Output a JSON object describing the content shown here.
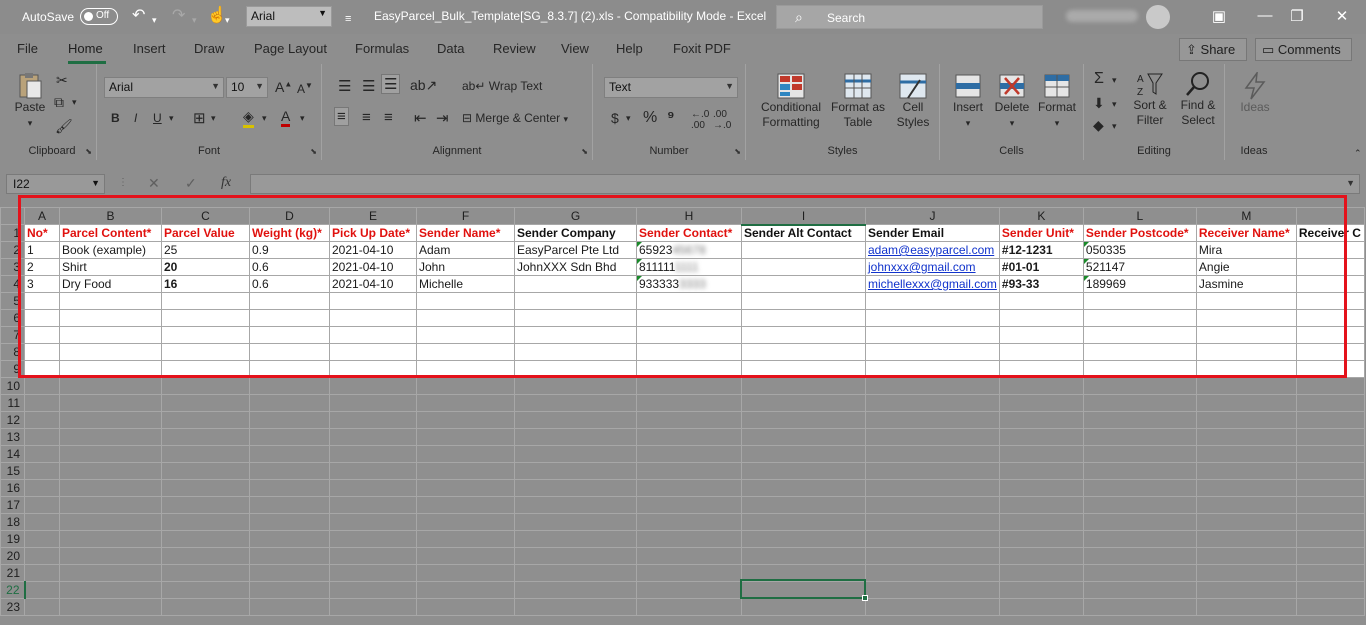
{
  "titlebar": {
    "autosave_label": "AutoSave",
    "autosave_state": "Off",
    "font_value": "Arial",
    "document_title": "EasyParcel_Bulk_Template[SG_8.3.7] (2).xls  -  Compatibility Mode  -  Excel",
    "search_placeholder": "Search"
  },
  "tabs": [
    "File",
    "Home",
    "Insert",
    "Draw",
    "Page Layout",
    "Formulas",
    "Data",
    "Review",
    "View",
    "Help",
    "Foxit PDF"
  ],
  "active_tab": "Home",
  "share_label": "Share",
  "comments_label": "Comments",
  "ribbon": {
    "clipboard": {
      "label": "Clipboard",
      "paste": "Paste"
    },
    "font": {
      "label": "Font",
      "family": "Arial",
      "size": "10",
      "bold": "B",
      "italic": "I",
      "underline": "U"
    },
    "alignment": {
      "label": "Alignment",
      "wrap_text": "Wrap Text",
      "merge_center": "Merge & Center"
    },
    "number": {
      "label": "Number",
      "format": "Text"
    },
    "styles": {
      "label": "Styles",
      "conditional": "Conditional Formatting",
      "format_table": "Format as Table",
      "cell_styles": "Cell Styles"
    },
    "cells": {
      "label": "Cells",
      "insert": "Insert",
      "delete": "Delete",
      "format": "Format"
    },
    "editing": {
      "label": "Editing",
      "sort_filter": "Sort & Filter",
      "find_select": "Find & Select"
    },
    "ideas": {
      "label": "Ideas",
      "ideas_btn": "Ideas"
    }
  },
  "formula_bar": {
    "name_box": "I22",
    "fx": "fx",
    "value": ""
  },
  "sheet": {
    "columns": [
      "A",
      "B",
      "C",
      "D",
      "E",
      "F",
      "G",
      "H",
      "I",
      "J",
      "K",
      "L",
      "M"
    ],
    "selected_column": "I",
    "selected_row": "22",
    "headers": [
      {
        "text": "No*",
        "required": true
      },
      {
        "text": "Parcel Content*",
        "required": true
      },
      {
        "text": "Parcel Value",
        "required": true
      },
      {
        "text": "Weight (kg)*",
        "required": true
      },
      {
        "text": "Pick Up Date*",
        "required": true
      },
      {
        "text": "Sender Name*",
        "required": true
      },
      {
        "text": "Sender Company",
        "required": false
      },
      {
        "text": "Sender Contact*",
        "required": true
      },
      {
        "text": "Sender Alt Contact",
        "required": false
      },
      {
        "text": "Sender Email",
        "required": false
      },
      {
        "text": "Sender Unit*",
        "required": true
      },
      {
        "text": "Sender Postcode*",
        "required": true
      },
      {
        "text": "Receiver Name*",
        "required": true
      },
      {
        "text": "Receiver C",
        "required": false
      }
    ],
    "rows": [
      {
        "no": "1",
        "content": "Book (example)",
        "value": "25",
        "weight": "0.9",
        "date": "2021-04-10",
        "sender": "Adam",
        "company": "EasyParcel Pte Ltd",
        "contact_visible": "65923",
        "contact_hidden": "45678",
        "alt": "",
        "email": "adam@easyparcel.com",
        "unit": "#12-1231",
        "postcode": "050335",
        "receiver": "Mira"
      },
      {
        "no": "2",
        "content": "Shirt",
        "value": "20",
        "weight": "0.6",
        "date": "2021-04-10",
        "sender": "John",
        "company": "JohnXXX Sdn Bhd",
        "contact_visible": "811111",
        "contact_hidden": "1111",
        "alt": "",
        "email": "johnxxx@gmail.com",
        "unit": "#01-01",
        "postcode": "521147",
        "receiver": "Angie"
      },
      {
        "no": "3",
        "content": "Dry Food",
        "value": "16",
        "weight": "0.6",
        "date": "2021-04-10",
        "sender": "Michelle",
        "company": "",
        "contact_visible": "933333",
        "contact_hidden": "3333",
        "alt": "",
        "email": "michellexxx@gmail.com",
        "unit": "#93-33",
        "postcode": "189969",
        "receiver": "Jasmine"
      }
    ],
    "row_numbers": [
      "1",
      "2",
      "3",
      "4",
      "5",
      "6",
      "7",
      "8",
      "9",
      "10",
      "11",
      "12",
      "13",
      "14",
      "15",
      "16",
      "17",
      "18",
      "19",
      "20",
      "21",
      "22",
      "23"
    ]
  },
  "colors": {
    "accent": "#1f6e43",
    "required_header": "#e0110e",
    "highlight_box": "#e4121b",
    "link": "#1133cc"
  }
}
